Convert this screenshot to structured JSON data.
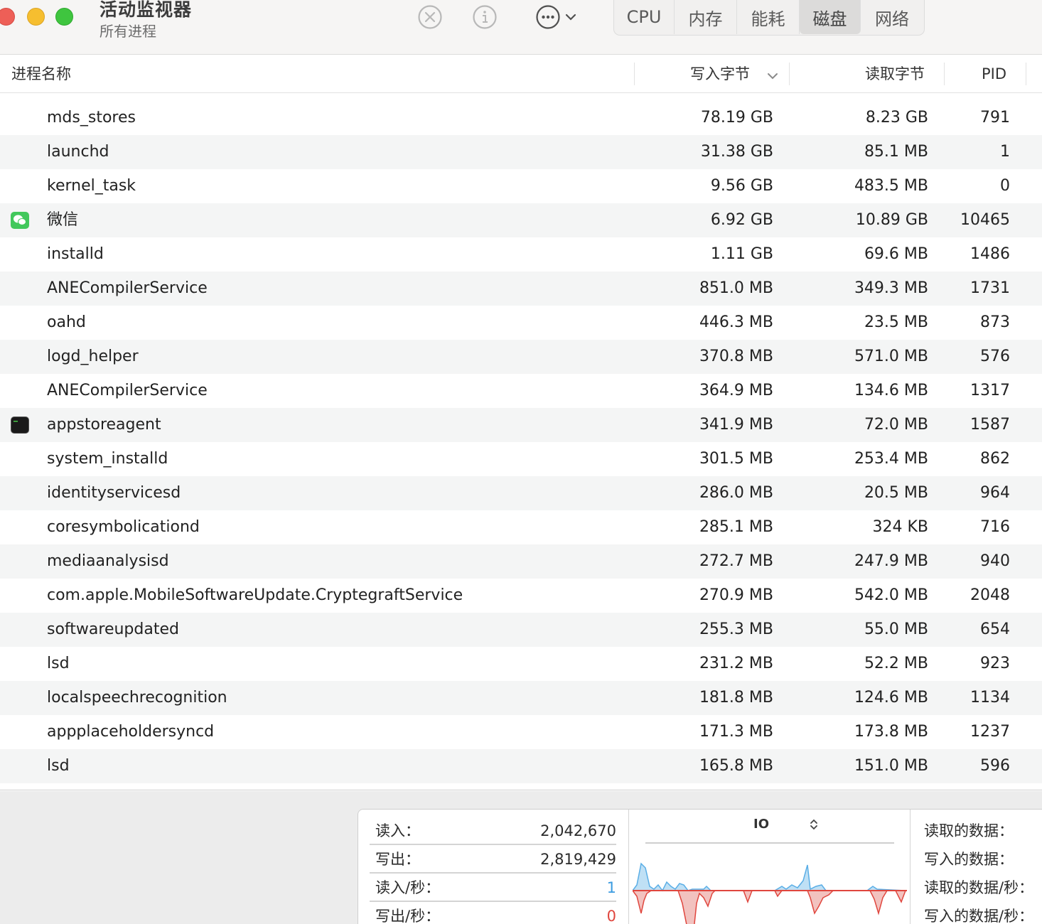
{
  "window": {
    "title": "活动监视器",
    "subtitle": "所有进程"
  },
  "tabs": [
    {
      "label": "CPU",
      "active": false
    },
    {
      "label": "内存",
      "active": false
    },
    {
      "label": "能耗",
      "active": false
    },
    {
      "label": "磁盘",
      "active": true
    },
    {
      "label": "网络",
      "active": false
    }
  ],
  "columns": {
    "name": "进程名称",
    "write": "写入字节",
    "read": "读取字节",
    "pid": "PID"
  },
  "rows": [
    {
      "name": "mds_stores",
      "write": "78.19 GB",
      "read": "8.23 GB",
      "pid": "791",
      "icon": null
    },
    {
      "name": "launchd",
      "write": "31.38 GB",
      "read": "85.1 MB",
      "pid": "1",
      "icon": null
    },
    {
      "name": "kernel_task",
      "write": "9.56 GB",
      "read": "483.5 MB",
      "pid": "0",
      "icon": null
    },
    {
      "name": "微信",
      "write": "6.92 GB",
      "read": "10.89 GB",
      "pid": "10465",
      "icon": "wechat-icon"
    },
    {
      "name": "installd",
      "write": "1.11 GB",
      "read": "69.6 MB",
      "pid": "1486",
      "icon": null
    },
    {
      "name": "ANECompilerService",
      "write": "851.0 MB",
      "read": "349.3 MB",
      "pid": "1731",
      "icon": null
    },
    {
      "name": "oahd",
      "write": "446.3 MB",
      "read": "23.5 MB",
      "pid": "873",
      "icon": null
    },
    {
      "name": "logd_helper",
      "write": "370.8 MB",
      "read": "571.0 MB",
      "pid": "576",
      "icon": null
    },
    {
      "name": "ANECompilerService",
      "write": "364.9 MB",
      "read": "134.6 MB",
      "pid": "1317",
      "icon": null
    },
    {
      "name": "appstoreagent",
      "write": "341.9 MB",
      "read": "72.0 MB",
      "pid": "1587",
      "icon": "terminal-icon"
    },
    {
      "name": "system_installd",
      "write": "301.5 MB",
      "read": "253.4 MB",
      "pid": "862",
      "icon": null
    },
    {
      "name": "identityservicesd",
      "write": "286.0 MB",
      "read": "20.5 MB",
      "pid": "964",
      "icon": null
    },
    {
      "name": "coresymbolicationd",
      "write": "285.1 MB",
      "read": "324 KB",
      "pid": "716",
      "icon": null
    },
    {
      "name": "mediaanalysisd",
      "write": "272.7 MB",
      "read": "247.9 MB",
      "pid": "940",
      "icon": null
    },
    {
      "name": "com.apple.MobileSoftwareUpdate.CryptegraftService",
      "write": "270.9 MB",
      "read": "542.0 MB",
      "pid": "2048",
      "icon": null
    },
    {
      "name": "softwareupdated",
      "write": "255.3 MB",
      "read": "55.0 MB",
      "pid": "654",
      "icon": null
    },
    {
      "name": "lsd",
      "write": "231.2 MB",
      "read": "52.2 MB",
      "pid": "923",
      "icon": null
    },
    {
      "name": "localspeechrecognition",
      "write": "181.8 MB",
      "read": "124.6 MB",
      "pid": "1134",
      "icon": null
    },
    {
      "name": "appplaceholdersyncd",
      "write": "171.3 MB",
      "read": "173.8 MB",
      "pid": "1237",
      "icon": null
    },
    {
      "name": "lsd",
      "write": "165.8 MB",
      "read": "151.0 MB",
      "pid": "596",
      "icon": null
    }
  ],
  "summary": {
    "reads_in_label": "读入：",
    "reads_in_value": "2,042,670",
    "writes_out_label": "写出：",
    "writes_out_value": "2,819,429",
    "reads_per_sec_label": "读入/秒：",
    "reads_per_sec_value": "1",
    "writes_per_sec_label": "写出/秒：",
    "writes_per_sec_value": "0",
    "chart_mode": "IO",
    "data_read_label": "读取的数据：",
    "data_written_label": "写入的数据：",
    "data_read_per_sec_label": "读取的数据/秒：",
    "data_written_per_sec_label": "写入的数据/秒："
  },
  "colors": {
    "read_series": "#5aaee6",
    "write_series": "#e0463e",
    "per_sec_read": "#3b9be0",
    "per_sec_write": "#e0463e"
  }
}
